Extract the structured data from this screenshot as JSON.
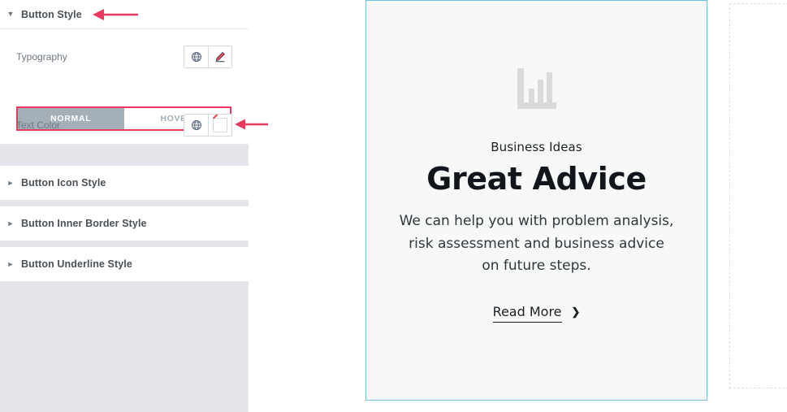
{
  "panel": {
    "open_section": {
      "title": "Button Style",
      "arrow_icon": "caret-down-icon",
      "controls": {
        "typography": {
          "label": "Typography",
          "globe_icon": "globe-icon",
          "edit_icon": "pencil-icon"
        },
        "state_tabs": {
          "tabs": [
            {
              "label": "NORMAL",
              "active": true
            },
            {
              "label": "HOVER",
              "active": false
            }
          ],
          "highlight_color": "#e8395c"
        },
        "text_color": {
          "label": "Text Color",
          "globe_icon": "globe-icon",
          "swatch_icon": "no-color-swatch-icon",
          "swatch_slash_color": "#e8394f"
        }
      }
    },
    "collapsed_sections": [
      {
        "title": "Button Icon Style",
        "arrow_icon": "caret-right-icon"
      },
      {
        "title": "Button Inner Border Style",
        "arrow_icon": "caret-right-icon"
      },
      {
        "title": "Button Underline Style",
        "arrow_icon": "caret-right-icon"
      }
    ],
    "collapse_handle": {
      "icon": "chevron-left-icon",
      "glyph": "‹"
    },
    "background_color": "#e4e6eb"
  },
  "annotations": [
    {
      "name": "arrow-to-button-style",
      "color": "#e8395c",
      "direction": "left"
    },
    {
      "name": "arrow-to-text-color",
      "color": "#e8395c",
      "direction": "left"
    }
  ],
  "canvas": {
    "card": {
      "border_color": "#6ec1e4",
      "background_color": "#f7f8f8",
      "icon": "bar-chart-icon",
      "icon_color": "#d8dadc",
      "eyebrow": "Business Ideas",
      "headline": "Great Advice",
      "body": "We can help you with problem analysis, risk assessment and business advice on future steps.",
      "read_more": {
        "label": "Read More",
        "chevron_icon": "chevron-right-icon",
        "chevron_glyph": "❯"
      }
    },
    "placeholder": {
      "name": "empty-column-placeholder",
      "border_style": "dashed",
      "border_color": "#dcdfe3"
    }
  }
}
